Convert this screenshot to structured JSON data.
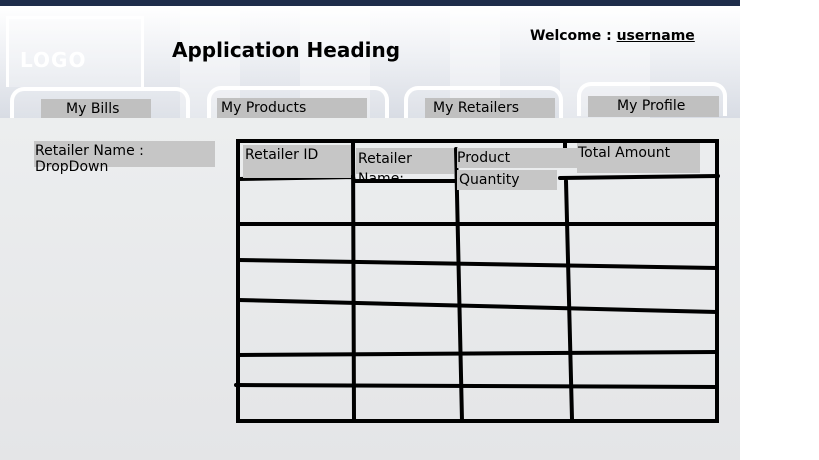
{
  "header": {
    "logo": "LOGO",
    "title": "Application Heading",
    "welcome_label": "Welcome :",
    "username": "username"
  },
  "tabs": [
    {
      "label": "My Bills"
    },
    {
      "label": "My Products"
    },
    {
      "label": "My Retailers"
    },
    {
      "label": "My Profile"
    }
  ],
  "filter": {
    "label": "Retailer Name : DropDown"
  },
  "table": {
    "columns": [
      "Retailer ID",
      "Retailer Name:",
      "Product Purchased",
      "Quantity",
      "Total Amount"
    ],
    "rows": [
      [
        "",
        "",
        "",
        ""
      ],
      [
        "",
        "",
        "",
        ""
      ],
      [
        "",
        "",
        "",
        ""
      ],
      [
        "",
        "",
        "",
        ""
      ],
      [
        "",
        "",
        "",
        ""
      ],
      [
        "",
        "",
        "",
        ""
      ]
    ]
  },
  "colors": {
    "topbar": "#1e2d4a",
    "label_fill": "#c6c6c6",
    "grid_lines": "#000000"
  }
}
